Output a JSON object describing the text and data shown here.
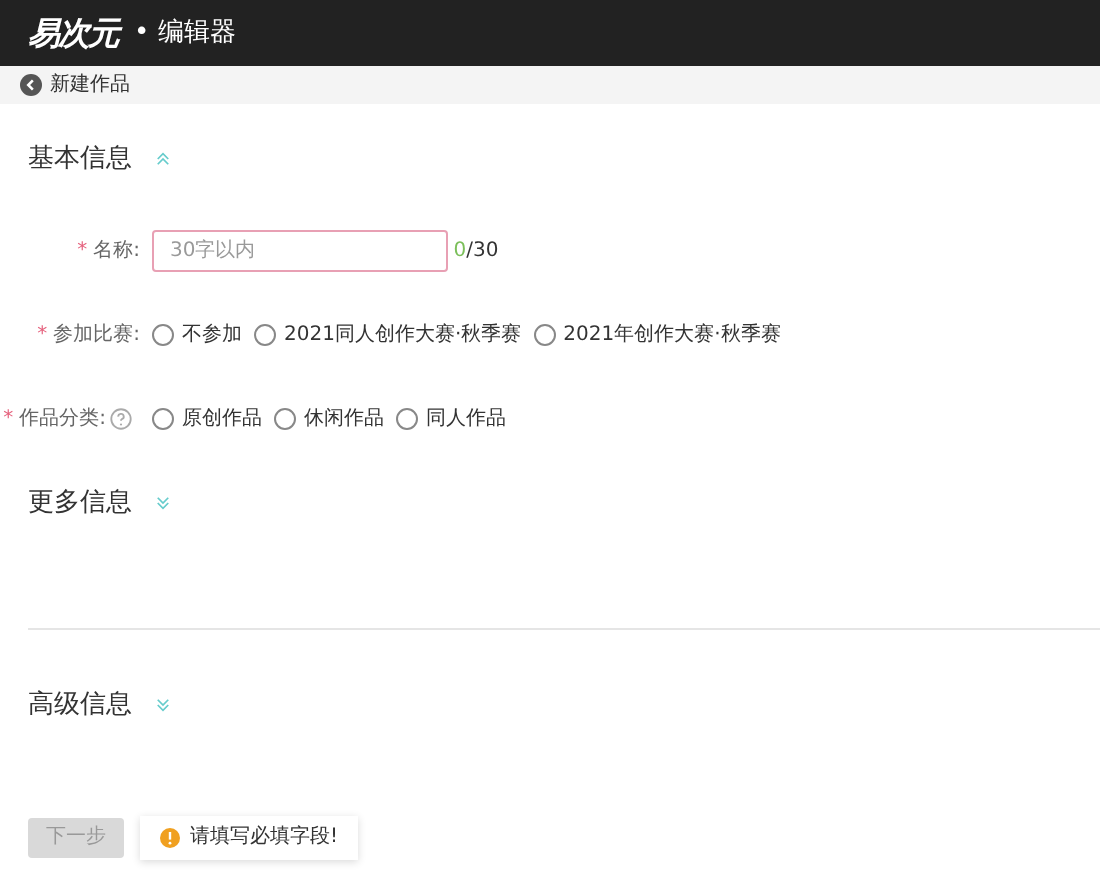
{
  "header": {
    "logo": "易次元",
    "title": "• 编辑器"
  },
  "breadcrumb": {
    "label": "新建作品"
  },
  "sections": [
    {
      "title": "基本信息",
      "expanded": true,
      "fields": [
        {
          "kind": "text",
          "label": "名称:",
          "required_mark": "*",
          "placeholder": "30字以内",
          "count": "0",
          "limit": "/30"
        },
        {
          "kind": "radio",
          "label": "参加比赛:",
          "required_mark": "*",
          "options": [
            {
              "label": "不参加",
              "selected": false
            },
            {
              "label": "2021同人创作大赛·秋季赛",
              "selected": false
            },
            {
              "label": "2021年创作大赛·秋季赛",
              "selected": false
            }
          ]
        },
        {
          "kind": "radio",
          "label": "作品分类:",
          "required_mark": "*",
          "help": true,
          "options": [
            {
              "label": "原创作品",
              "selected": false
            },
            {
              "label": "休闲作品",
              "selected": false
            },
            {
              "label": "同人作品",
              "selected": false
            }
          ]
        }
      ]
    },
    {
      "title": "更多信息",
      "expanded": false,
      "divider": true
    },
    {
      "title": "高级信息",
      "expanded": false
    }
  ],
  "next_button": {
    "label": "下一步",
    "disabled": true
  },
  "toast": {
    "message": "请填写必填字段!"
  }
}
